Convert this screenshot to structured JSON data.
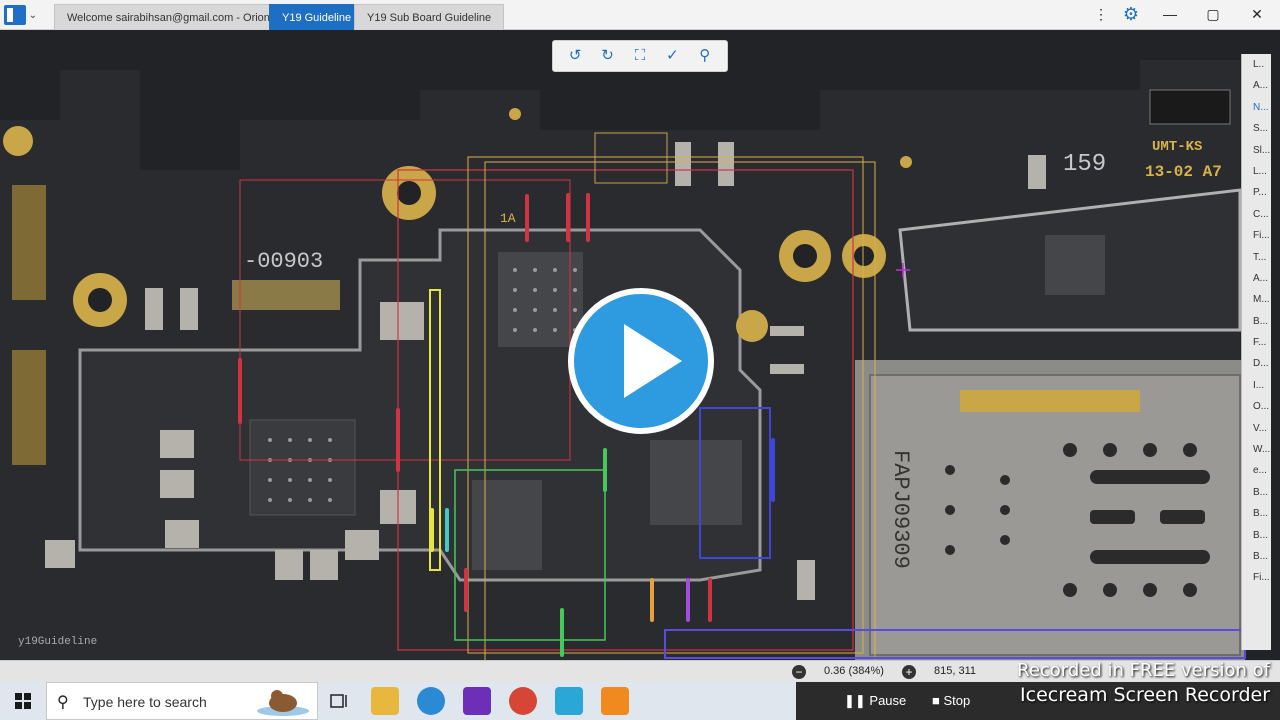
{
  "titlebar": {
    "tabs": [
      {
        "label": "Welcome sairabihsan@gmail.com - Orion",
        "active": false
      },
      {
        "label": "Y19 Guideline",
        "active": true
      },
      {
        "label": "Y19 Sub Board Guideline",
        "active": false
      }
    ],
    "menu_icon": "kebab-icon",
    "settings_icon": "gear-icon",
    "minimize": "—",
    "maximize": "▢",
    "close": "✕",
    "accent_color": "#1e6fc4"
  },
  "toolbar": {
    "rotate_left": "↺",
    "rotate_right": "↻",
    "fit": "⛶",
    "select": "✓",
    "search": "⚲"
  },
  "board": {
    "silk_labels": [
      "-00903",
      "159",
      "UMT-KS",
      "13-02 A7",
      "FAPJ09309",
      "1A"
    ],
    "watermark": "y19Guideline"
  },
  "right_panel": {
    "items": [
      "L..",
      "A...",
      "N...",
      "S...",
      "Sl...",
      "L...",
      "P...",
      "C...",
      "Fi...",
      "T...",
      "A...",
      "M...",
      "B...",
      "F...",
      "D...",
      "I...",
      "O...",
      "V...",
      "W...",
      "e...",
      "B...",
      "B...",
      "B...",
      "B...",
      "Fi..."
    ]
  },
  "status": {
    "zoom": "0.36 (384%)",
    "coords": "815, 311"
  },
  "recorder": {
    "line1": "Recorded in FREE version of",
    "line2": "Icecream  Screen  Recorder",
    "pause_label": "Pause",
    "stop_label": "Stop"
  },
  "taskbar": {
    "search_placeholder": "Type here to search"
  }
}
